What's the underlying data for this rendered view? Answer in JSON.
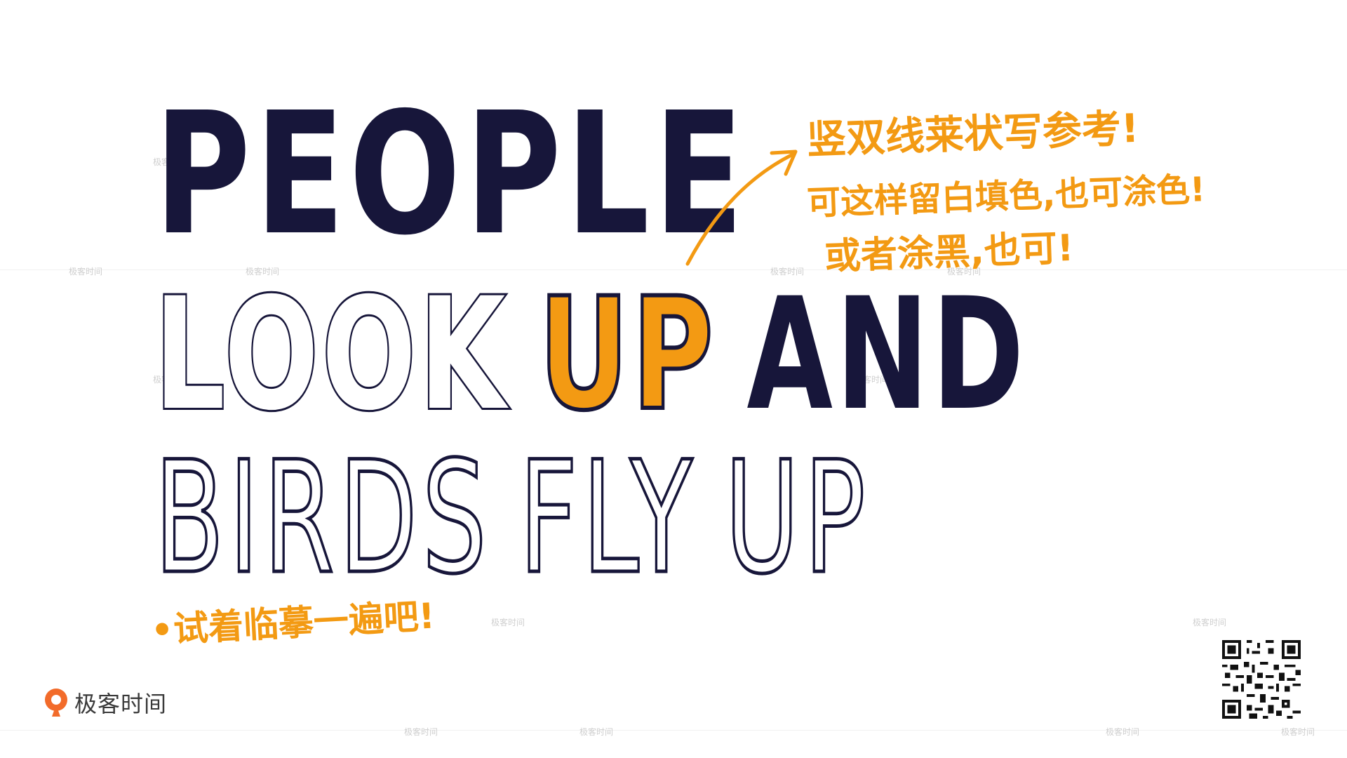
{
  "lettering": {
    "line1": "PEOPLE",
    "line2_word1": "LOOK",
    "line2_word2": "UP",
    "line2_word3": "AND",
    "line3_word1": "BIRDS",
    "line3_word2": "FLY",
    "line3_word3": "UP"
  },
  "notes": {
    "line1": "竖双线莱状写参考!",
    "line2": "可这样留白填色,也可涂色!",
    "line3": "或者涂黑,也可!",
    "bottom": "•试着临摹一遍吧!"
  },
  "logo": {
    "text": "极客时间",
    "icon": "geektime-logo-icon"
  },
  "watermark": {
    "text": "极客时间"
  },
  "colors": {
    "ink": "#17163a",
    "accent": "#f39a13",
    "background": "#ffffff"
  },
  "qr_icon": "qr-code-icon"
}
